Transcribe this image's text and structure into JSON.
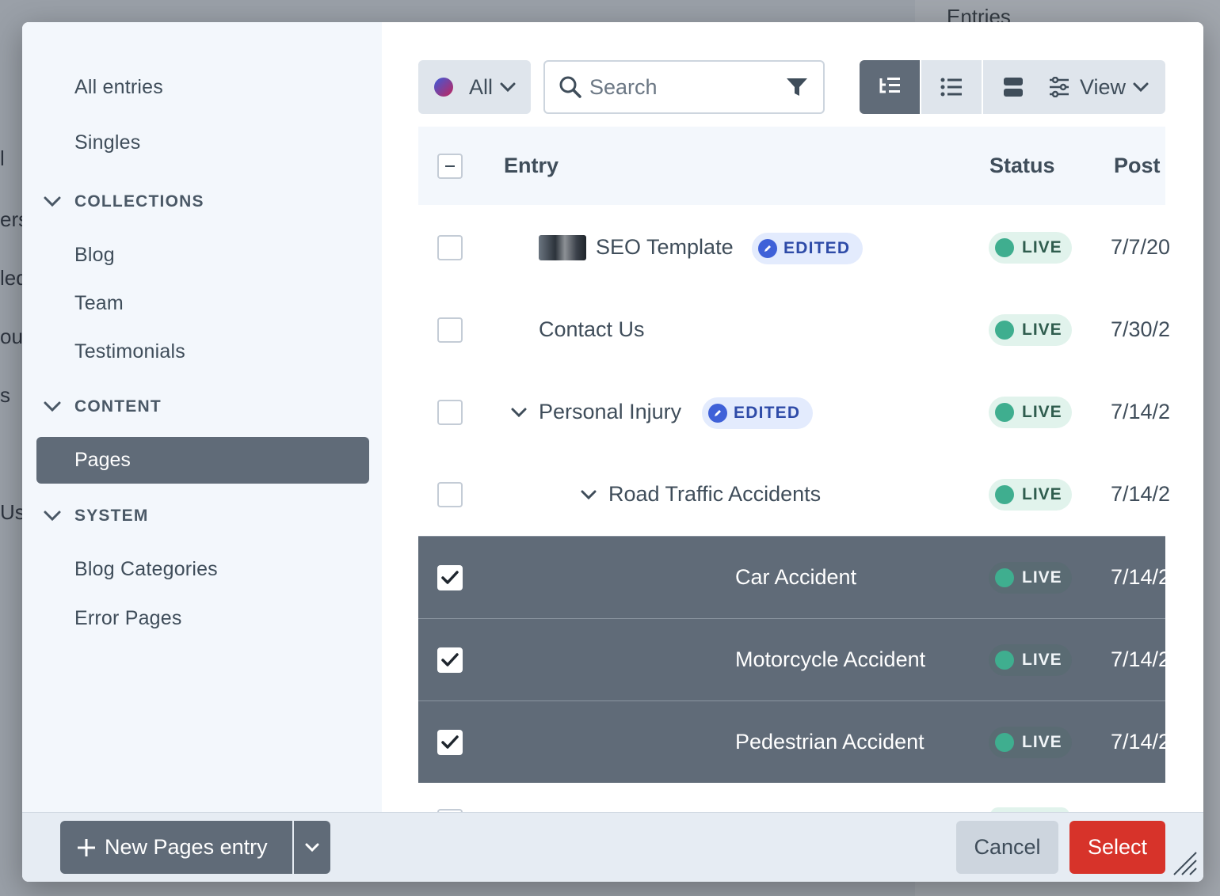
{
  "background": {
    "right_title": "Entries",
    "left_fragments": [
      "l",
      "ers",
      "led",
      "ou",
      "s",
      "Us"
    ]
  },
  "sidebar": {
    "items_top": [
      {
        "label": "All entries"
      },
      {
        "label": "Singles"
      }
    ],
    "groups": [
      {
        "heading": "COLLECTIONS",
        "items": [
          "Blog",
          "Team",
          "Testimonials"
        ]
      },
      {
        "heading": "CONTENT",
        "items": [
          "Pages"
        ]
      },
      {
        "heading": "SYSTEM",
        "items": [
          "Blog Categories",
          "Error Pages"
        ]
      }
    ],
    "selected": "Pages"
  },
  "toolbar": {
    "site_label": "All",
    "search_placeholder": "Search",
    "view_label": "View",
    "view_modes": [
      "structure-view-icon",
      "list-view-icon",
      "cards-view-icon"
    ],
    "active_view_mode": "structure-view-icon"
  },
  "table": {
    "headers": {
      "entry": "Entry",
      "status": "Status",
      "post": "Post"
    },
    "rows": [
      {
        "title": "SEO Template",
        "badge": "EDITED",
        "status": "LIVE",
        "date": "7/7/20",
        "selected": false,
        "has_thumb": true
      },
      {
        "title": "Contact Us",
        "badge": "",
        "status": "LIVE",
        "date": "7/30/2",
        "selected": false
      },
      {
        "title": "Personal Injury",
        "badge": "EDITED",
        "status": "LIVE",
        "date": "7/14/2",
        "selected": false,
        "expanded": true
      },
      {
        "title": "Road Traffic Accidents",
        "badge": "",
        "status": "LIVE",
        "date": "7/14/2",
        "selected": false,
        "expanded": true
      },
      {
        "title": "Car Accident",
        "badge": "",
        "status": "LIVE",
        "date": "7/14/2",
        "selected": true
      },
      {
        "title": "Motorcycle Accident",
        "badge": "",
        "status": "LIVE",
        "date": "7/14/2",
        "selected": true
      },
      {
        "title": "Pedestrian Accident",
        "badge": "",
        "status": "LIVE",
        "date": "7/14/2",
        "selected": true
      }
    ]
  },
  "footer": {
    "new_entry_label": "New Pages entry",
    "cancel_label": "Cancel",
    "select_label": "Select"
  },
  "colors": {
    "selected_row": "#606b78",
    "primary_red": "#d7332a",
    "live_green": "#3fae8f",
    "edited_blue": "#3f61d8"
  }
}
